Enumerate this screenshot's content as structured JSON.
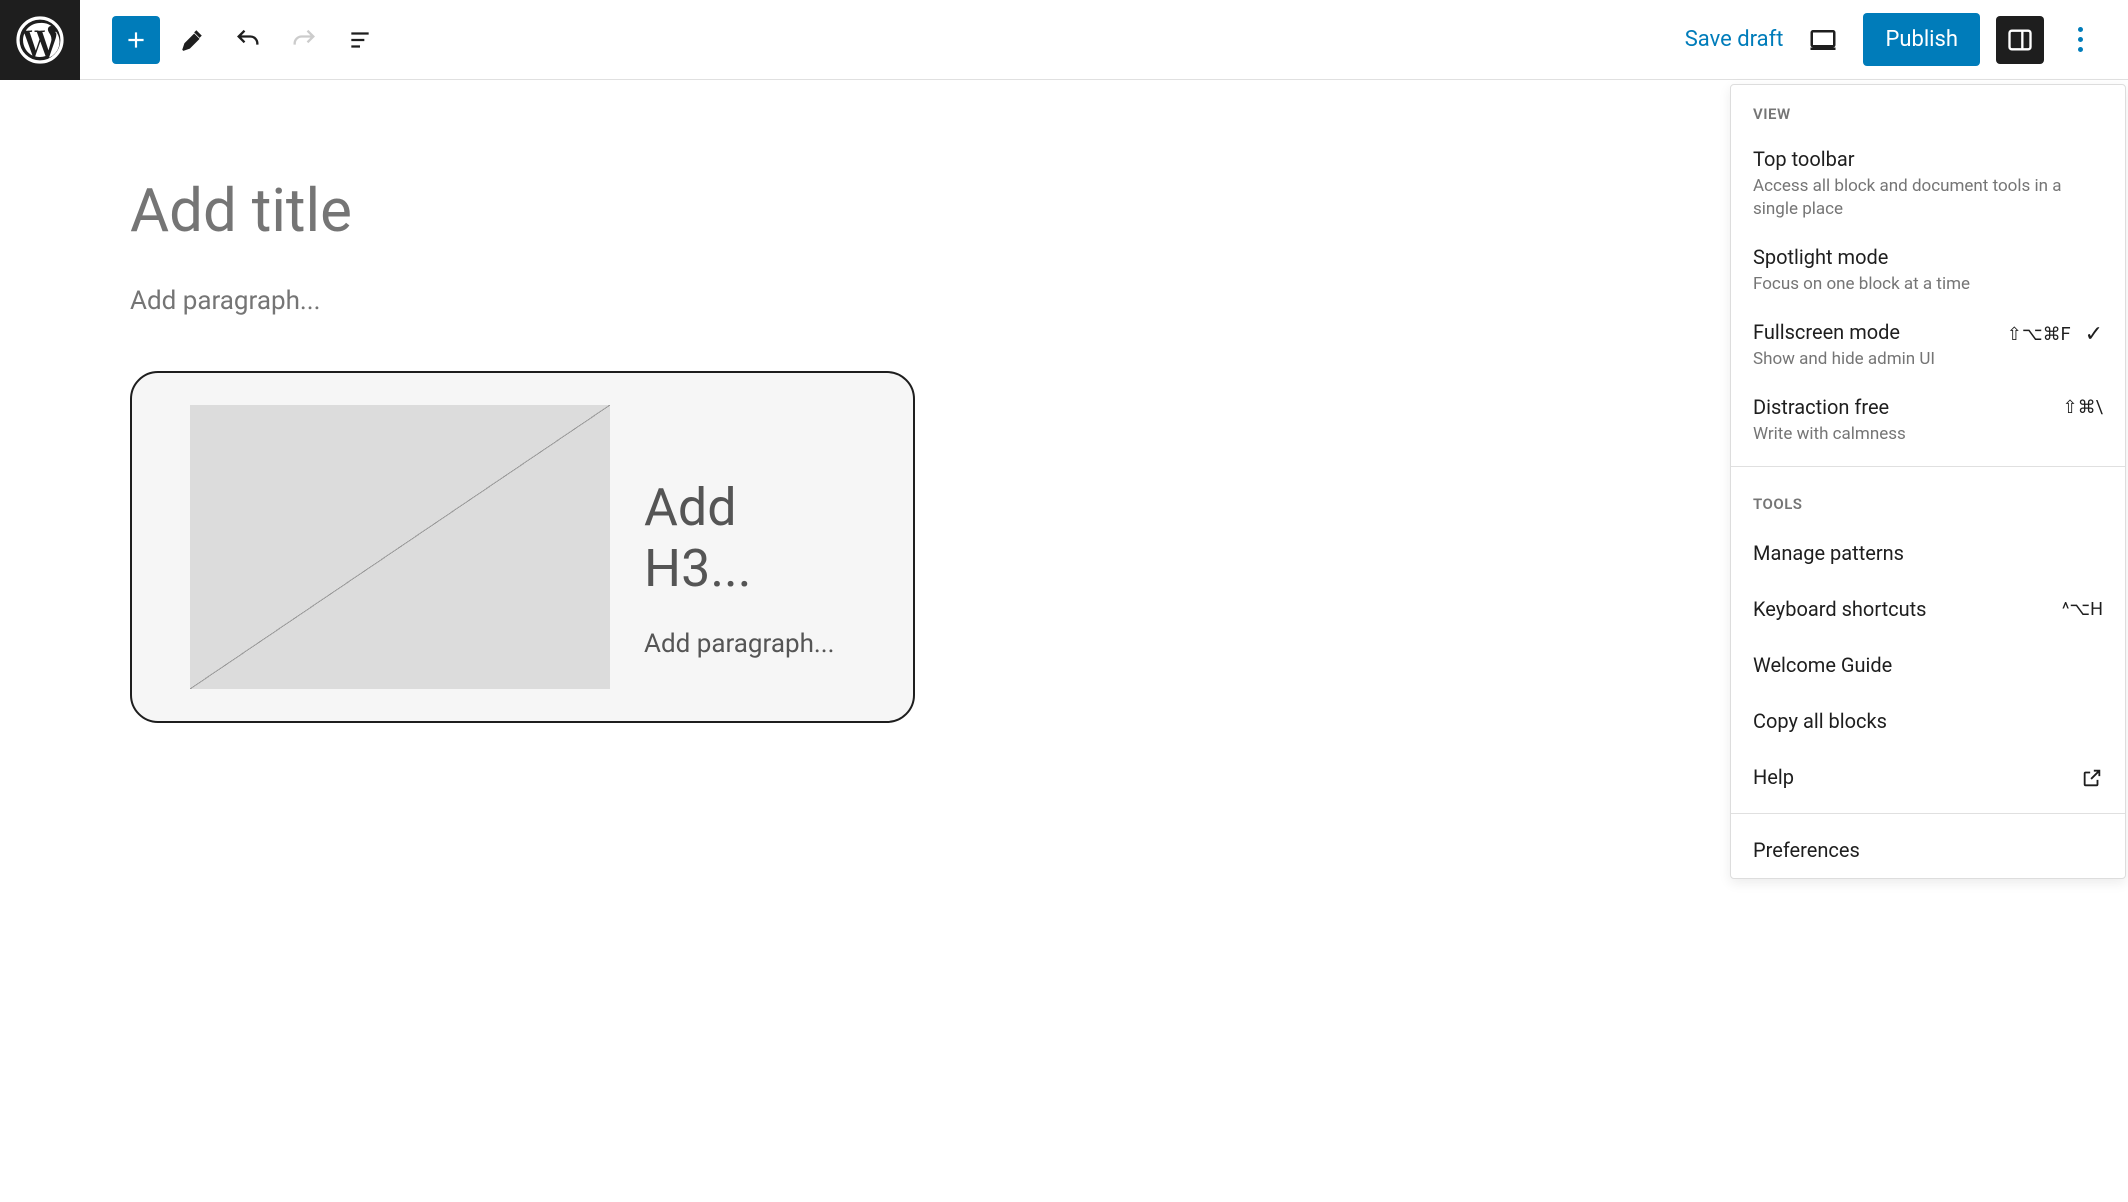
{
  "toolbar": {
    "save_draft": "Save draft",
    "publish": "Publish"
  },
  "editor": {
    "title_placeholder": "Add title",
    "paragraph_placeholder": "Add paragraph...",
    "h3_placeholder": "Add H3...",
    "block_paragraph_placeholder": "Add paragraph..."
  },
  "menu": {
    "section_view": "VIEW",
    "section_tools": "TOOLS",
    "top_toolbar": {
      "title": "Top toolbar",
      "desc": "Access all block and document tools in a single place"
    },
    "spotlight": {
      "title": "Spotlight mode",
      "desc": "Focus on one block at a time"
    },
    "fullscreen": {
      "title": "Fullscreen mode",
      "desc": "Show and hide admin UI",
      "shortcut": "⇧⌥⌘F",
      "checked": true
    },
    "distraction": {
      "title": "Distraction free",
      "desc": "Write with calmness",
      "shortcut": "⇧⌘\\"
    },
    "manage_patterns": "Manage patterns",
    "keyboard_shortcuts": {
      "title": "Keyboard shortcuts",
      "shortcut": "^⌥H"
    },
    "welcome_guide": "Welcome Guide",
    "copy_all": "Copy all blocks",
    "help": "Help",
    "preferences": "Preferences"
  }
}
